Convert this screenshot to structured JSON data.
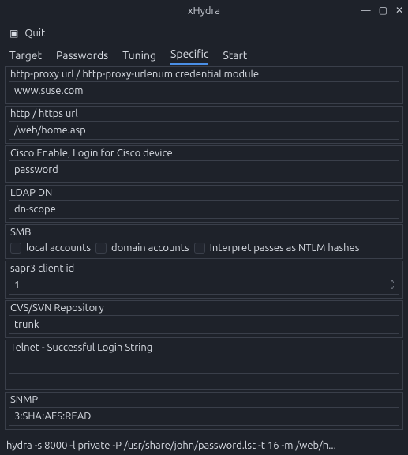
{
  "window": {
    "title": "xHydra"
  },
  "menu": {
    "quit": "Quit"
  },
  "tabs": {
    "target": "Target",
    "passwords": "Passwords",
    "tuning": "Tuning",
    "specific": "Specific",
    "start": "Start"
  },
  "groups": {
    "httpproxy": {
      "label": "http-proxy url / http-proxy-urlenum credential module",
      "value": "www.suse.com"
    },
    "httpurl": {
      "label": "http / https url",
      "value": "/web/home.asp"
    },
    "cisco": {
      "label": "Cisco Enable, Login for Cisco device",
      "value": "password"
    },
    "ldap": {
      "label": "LDAP DN",
      "value": "dn-scope"
    },
    "smb": {
      "label": "SMB",
      "local": "local accounts",
      "domain": "domain accounts",
      "ntlm": "Interpret passes as NTLM hashes"
    },
    "sapr3": {
      "label": "sapr3 client id",
      "value": "1"
    },
    "cvssvn": {
      "label": "CVS/SVN Repository",
      "value": "trunk"
    },
    "telnet": {
      "label": "Telnet - Successful Login String",
      "value": ""
    },
    "snmp": {
      "label": "SNMP",
      "value": "3:SHA:AES:READ"
    }
  },
  "status": "hydra -s 8000 -l private -P /usr/share/john/password.lst -t 16 -m /web/h..."
}
